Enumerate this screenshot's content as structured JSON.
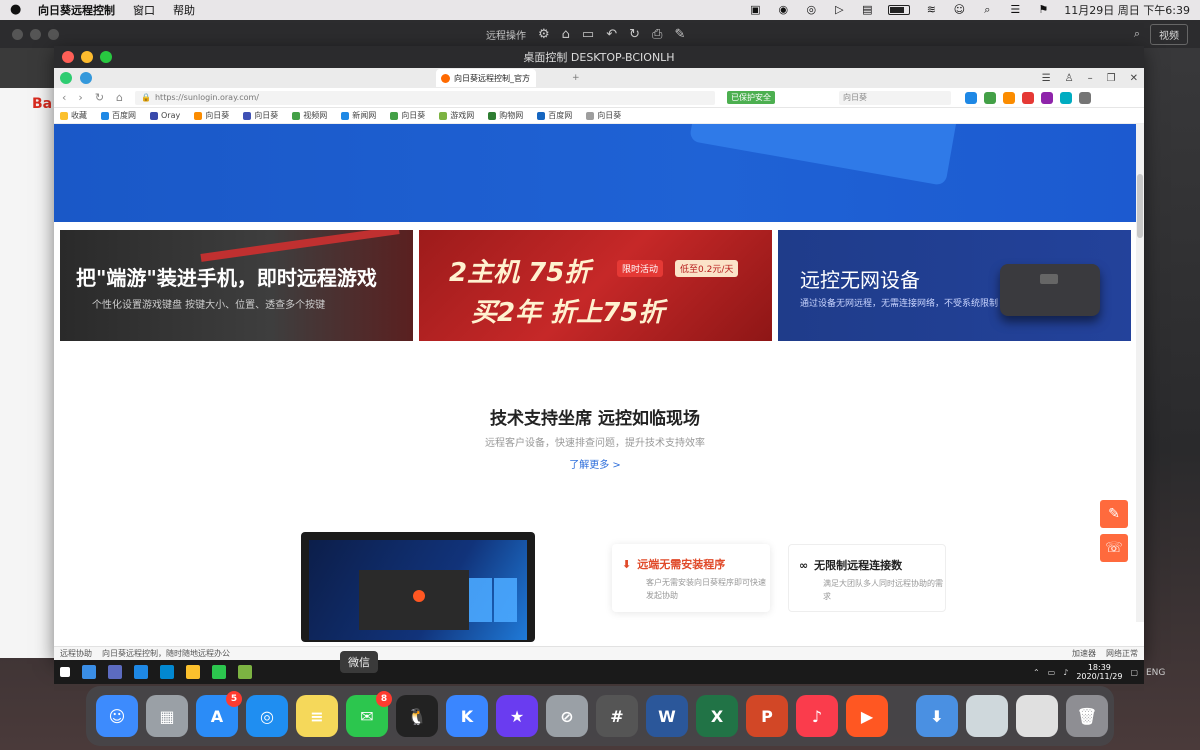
{
  "menubar": {
    "app_name": "向日葵远程控制",
    "items": [
      "窗口",
      "帮助"
    ],
    "datetime": "11月29日 周日 下午6:39"
  },
  "outer": {
    "toolbar_label": "远程操作",
    "right_button": "视频"
  },
  "bgpage": {
    "logo": "Ba"
  },
  "window": {
    "title": "桌面控制 DESKTOP-BCIONLH",
    "tab_title": "向日葵远程控制_官方",
    "url": "https://sunlogin.oray.com/",
    "url_badge": "已保护安全",
    "search_placeholder": "向日葵",
    "bookmarks": [
      "收藏",
      "百度网",
      "Oray",
      "向日葵",
      "向日葵",
      "视频网",
      "新闻网",
      "向日葵",
      "游戏网",
      "购物网",
      "百度网",
      "向日葵"
    ]
  },
  "banners": {
    "b1_title": "把\"端游\"装进手机，即时远程游戏",
    "b1_sub": "个性化设置游戏键盘 按键大小、位置、透查多个按键",
    "b2_line1": "2主机 75折",
    "b2_line2": "买2年 折上75折",
    "b2_tag1": "限时活动",
    "b2_tag2": "低至0.2元/天",
    "b3_title": "远控无网设备",
    "b3_sub": "通过设备无网远程，无需连接网络，不受系统限制"
  },
  "section": {
    "title": "技术支持坐席 远控如临现场",
    "subtitle": "远程客户设备，快速排查问题，提升技术支持效率",
    "link": "了解更多 >"
  },
  "cards": [
    {
      "icon": "download-icon",
      "title": "远端无需安装程序",
      "desc": "客户无需安装向日葵程序即可快速发起协助"
    },
    {
      "icon": "link-icon",
      "title": "无限制远程连接数",
      "desc": "满足大团队多人同时远程协助的需求"
    }
  ],
  "statusbar": {
    "left": "远程协助",
    "notice": "向日葵远程控制，随时随地远程办公",
    "right1": "加速器",
    "right2": "网络正常"
  },
  "taskbar": {
    "clock_time": "18:39",
    "clock_date": "2020/11/29",
    "ime": "ENG"
  },
  "tooltip": "微信",
  "dock": {
    "apps": [
      {
        "name": "finder",
        "color": "#3d8bfd",
        "glyph": "☺"
      },
      {
        "name": "launchpad",
        "color": "#9aa0a6",
        "glyph": "▦"
      },
      {
        "name": "app-store",
        "color": "#2b8cf7",
        "glyph": "A",
        "badge": "5"
      },
      {
        "name": "safari",
        "color": "#1f8ef1",
        "glyph": "◎"
      },
      {
        "name": "notes",
        "color": "#f5d85a",
        "glyph": "≡"
      },
      {
        "name": "wechat",
        "color": "#2cc64e",
        "glyph": "✉",
        "badge": "8"
      },
      {
        "name": "qq",
        "color": "#222222",
        "glyph": "🐧"
      },
      {
        "name": "kugou",
        "color": "#3a86ff",
        "glyph": "K"
      },
      {
        "name": "imovie",
        "color": "#6a3cf0",
        "glyph": "★"
      },
      {
        "name": "no-entry",
        "color": "#9aa0a6",
        "glyph": "⊘"
      },
      {
        "name": "calculator",
        "color": "#555555",
        "glyph": "#"
      },
      {
        "name": "word",
        "color": "#2b579a",
        "glyph": "W"
      },
      {
        "name": "excel",
        "color": "#217346",
        "glyph": "X"
      },
      {
        "name": "powerpoint",
        "color": "#d24726",
        "glyph": "P"
      },
      {
        "name": "music",
        "color": "#fa3c4c",
        "glyph": "♪"
      },
      {
        "name": "sunlogin",
        "color": "#ff5722",
        "glyph": "▶"
      },
      {
        "name": "downloads",
        "color": "#4a90e2",
        "glyph": "⬇"
      },
      {
        "name": "window-preview-1",
        "color": "#cfd8dc",
        "glyph": ""
      },
      {
        "name": "window-preview-2",
        "color": "#e0e0e0",
        "glyph": ""
      },
      {
        "name": "trash",
        "color": "#8e8e93",
        "glyph": "🗑"
      }
    ]
  },
  "colors": {
    "accent": "#ff6a3d",
    "hero_blue": "#1f62d5",
    "banner_red": "#c62828"
  }
}
